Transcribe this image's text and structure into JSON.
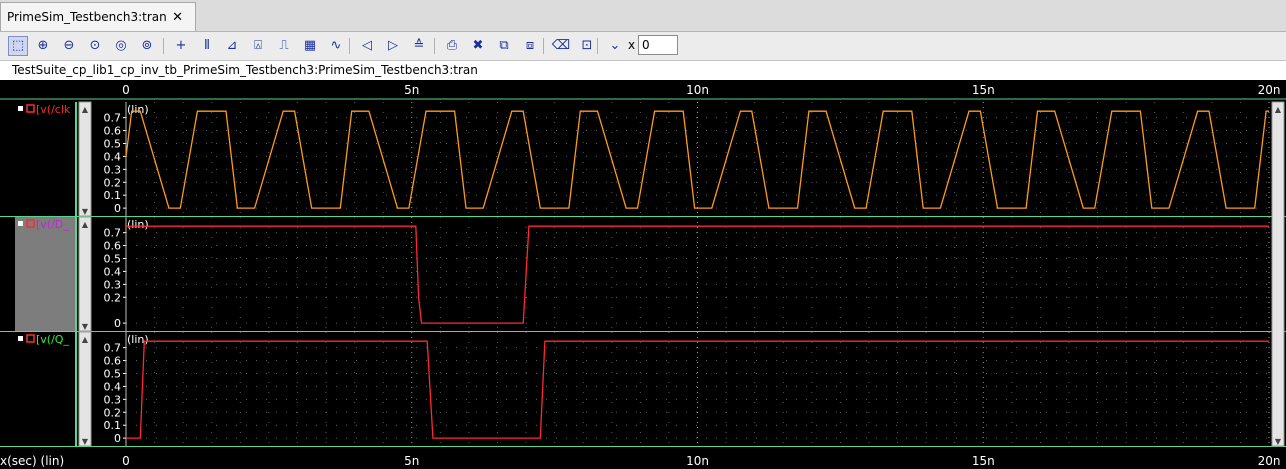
{
  "tab": {
    "title": "PrimeSim_Testbench3:tran",
    "close": "✕"
  },
  "toolbar": {
    "buttons": [
      {
        "name": "zoom-fit-icon",
        "glyph": "⬚"
      },
      {
        "name": "zoom-in-icon",
        "glyph": "⊕"
      },
      {
        "name": "zoom-out-icon",
        "glyph": "⊖"
      },
      {
        "name": "zoom-x-icon",
        "glyph": "⊙"
      },
      {
        "name": "zoom-y-icon",
        "glyph": "◎"
      },
      {
        "name": "zoom-box-icon",
        "glyph": "⊚"
      },
      {
        "name": "crosshair-icon",
        "glyph": "+"
      },
      {
        "name": "vertical-markers-icon",
        "glyph": "⫴"
      },
      {
        "name": "delta-icon",
        "glyph": "⊿"
      },
      {
        "name": "label-icon",
        "glyph": "⍓"
      },
      {
        "name": "pulse-icon",
        "glyph": "⎍"
      },
      {
        "name": "grid-icon",
        "glyph": "▦"
      },
      {
        "name": "waveform-icon",
        "glyph": "∿"
      },
      {
        "name": "prev-icon",
        "glyph": "◁"
      },
      {
        "name": "next-icon",
        "glyph": "▷"
      },
      {
        "name": "compare-icon",
        "glyph": "≙"
      },
      {
        "name": "print-icon",
        "glyph": "⎙"
      },
      {
        "name": "delete-icon",
        "glyph": "✖"
      },
      {
        "name": "stack-icon",
        "glyph": "⧉"
      },
      {
        "name": "split-icon",
        "glyph": "⧈"
      },
      {
        "name": "eraser-icon",
        "glyph": "⌫"
      },
      {
        "name": "frame-icon",
        "glyph": "⊡"
      },
      {
        "name": "down-icon",
        "glyph": "⌄"
      }
    ],
    "x_label": "x",
    "x_value": "0"
  },
  "window_title": "TestSuite_cp_lib1_cp_inv_tb_PrimeSim_Testbench3:PrimeSim_Testbench3:tran",
  "colors": {
    "background": "#000000",
    "grid": "#9a9a9a",
    "axis_text": "#ffffff",
    "clk": "#ff9a1a",
    "d": "#ff2a2a",
    "q": "#ff2a2a",
    "name_clk": "#ff2a2a",
    "name_d": "#c026d3",
    "name_q": "#33ee33",
    "strip_sel": "#7d7d7d",
    "separator": "#57d68f"
  },
  "chart_data": {
    "type": "line",
    "xlabel": "x(sec) (lin)",
    "xlim": [
      0,
      20
    ],
    "x_tick_values": [
      0,
      5,
      10,
      15,
      20
    ],
    "x_tick_labels": [
      "0",
      "5n",
      "10n",
      "15n",
      "20n"
    ],
    "panels": [
      {
        "id": "clk",
        "name": "[v(/clk",
        "scale": "(lin)",
        "ylim": [
          -0.03,
          0.79
        ],
        "y_ticks": [
          "0",
          "0.1",
          "0.2",
          "0.3",
          "0.4",
          "0.5",
          "0.6",
          "0.7"
        ],
        "series": {
          "x": [
            0,
            0.1,
            0.25,
            0.75,
            0.95,
            1.25,
            1.75,
            1.95,
            2.25,
            2.75,
            2.95,
            3.25,
            3.75,
            3.95,
            4.25,
            4.75,
            4.95,
            5.25,
            5.75,
            5.95,
            6.25,
            6.75,
            6.95,
            7.25,
            7.75,
            7.95,
            8.25,
            8.75,
            8.95,
            9.25,
            9.75,
            9.95,
            10.25,
            10.75,
            10.95,
            11.25,
            11.75,
            11.95,
            12.25,
            12.75,
            12.95,
            13.25,
            13.75,
            13.95,
            14.25,
            14.75,
            14.95,
            15.25,
            15.75,
            15.95,
            16.25,
            16.75,
            16.95,
            17.25,
            17.75,
            17.95,
            18.25,
            18.75,
            18.95,
            19.25,
            19.75,
            19.95,
            20
          ],
          "y": [
            0.4,
            0.75,
            0.75,
            0,
            0,
            0.75,
            0.75,
            0,
            0,
            0.75,
            0.75,
            0,
            0,
            0.75,
            0.75,
            0,
            0,
            0.75,
            0.75,
            0,
            0,
            0.75,
            0.75,
            0,
            0,
            0.75,
            0.75,
            0,
            0,
            0.75,
            0.75,
            0,
            0,
            0.75,
            0.75,
            0,
            0,
            0.75,
            0.75,
            0,
            0,
            0.75,
            0.75,
            0,
            0,
            0.75,
            0.75,
            0,
            0,
            0.75,
            0.75,
            0,
            0,
            0.75,
            0.75,
            0,
            0,
            0.75,
            0.75,
            0,
            0,
            0.75,
            0.75
          ]
        }
      },
      {
        "id": "d",
        "name": "[v(/D_",
        "scale": "(lin)",
        "ylim": [
          -0.03,
          0.79
        ],
        "y_ticks": [
          "0",
          "0.2",
          "0.3",
          "0.4",
          "0.5",
          "0.6",
          "0.7"
        ],
        "series": {
          "x": [
            0,
            5.07,
            5.12,
            5.17,
            6.95,
            7.05,
            20
          ],
          "y": [
            0.75,
            0.75,
            0.2,
            0,
            0,
            0.75,
            0.75
          ]
        }
      },
      {
        "id": "q",
        "name": "[v(/Q_",
        "scale": "(lin)",
        "ylim": [
          -0.03,
          0.79
        ],
        "y_ticks": [
          "0",
          "0.1",
          "0.2",
          "0.3",
          "0.4",
          "0.5",
          "0.6",
          "0.7"
        ],
        "series": {
          "x": [
            0,
            0.25,
            0.32,
            5.27,
            5.37,
            7.25,
            7.33,
            20
          ],
          "y": [
            0,
            0,
            0.75,
            0.75,
            0,
            0,
            0.75,
            0.75
          ]
        }
      }
    ]
  }
}
